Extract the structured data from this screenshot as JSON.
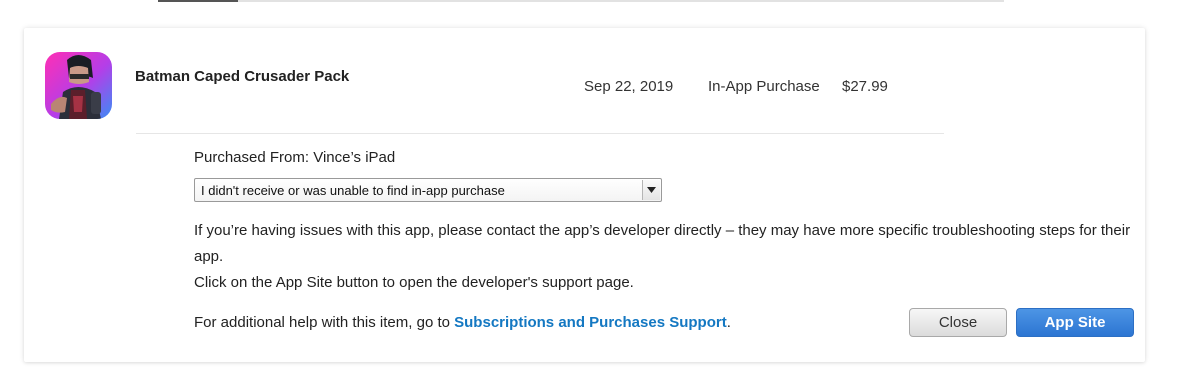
{
  "header": {
    "active_tab_label": ""
  },
  "purchase": {
    "item_name": "Batman Caped Crusader Pack",
    "date": "Sep 22, 2019",
    "type": "In-App Purchase",
    "price": "$27.99",
    "icon": "game-character-icon"
  },
  "details": {
    "purchased_from": "Purchased From: Vince’s iPad",
    "problem_select": {
      "selected": "I didn't receive or was unable to find in-app purchase"
    },
    "help_line1": "If you’re having issues with this app, please contact the app’s developer directly – they may have more specific troubleshooting steps for their app.",
    "help_line2": "Click on the App Site button to open the developer's support page."
  },
  "footer": {
    "prefix": "For additional help with this item, go to ",
    "link_label": "Subscriptions and Purchases Support",
    "suffix": "."
  },
  "buttons": {
    "close_label": "Close",
    "app_site_label": "App Site"
  },
  "colors": {
    "link": "#1478c2",
    "primary_button": "#2c75d2"
  }
}
